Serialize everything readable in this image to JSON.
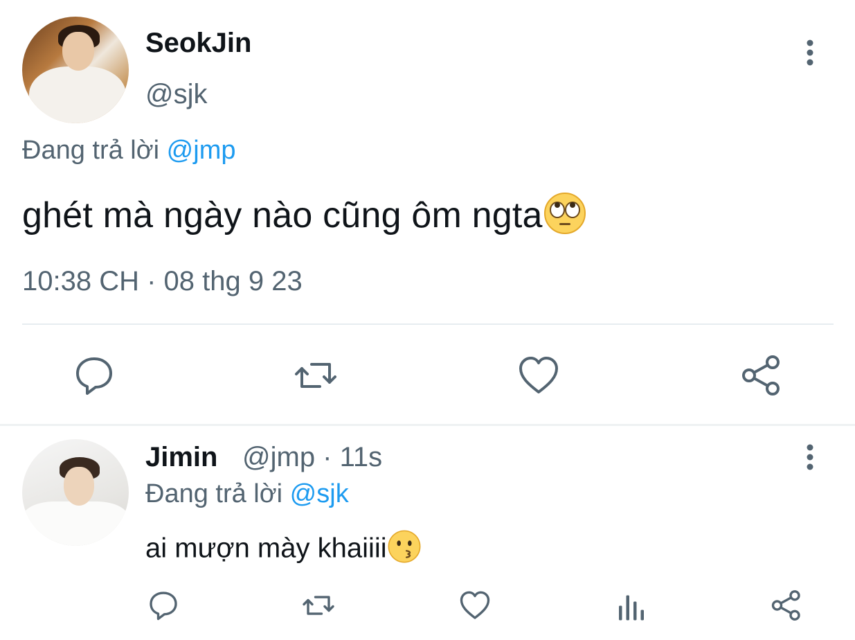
{
  "main_tweet": {
    "author_name": "SeokJin",
    "author_handle": "@sjk",
    "reply_prefix": "Đang trả lời ",
    "reply_to": "@jmp",
    "text": "ghét mà ngày nào cũng ôm ngta",
    "emoji": "face-with-rolling-eyes",
    "timestamp": "10:38 CH · 08 thg 9 23",
    "actions": [
      "reply-icon",
      "retweet-icon",
      "like-icon",
      "share-icon"
    ]
  },
  "reply_tweet": {
    "author_name": "Jimin",
    "meta": "@jmp · 11s",
    "reply_prefix": "Đang trả lời ",
    "reply_to": "@sjk",
    "text": "ai mượn mày khaiiii",
    "emoji": "kissing-face",
    "actions": [
      "reply-icon",
      "retweet-icon",
      "like-icon",
      "analytics-icon",
      "share-icon"
    ]
  },
  "colors": {
    "text_primary": "#0f1419",
    "text_secondary": "#536471",
    "link": "#1d9bf0",
    "divider": "#e6ecf0"
  }
}
